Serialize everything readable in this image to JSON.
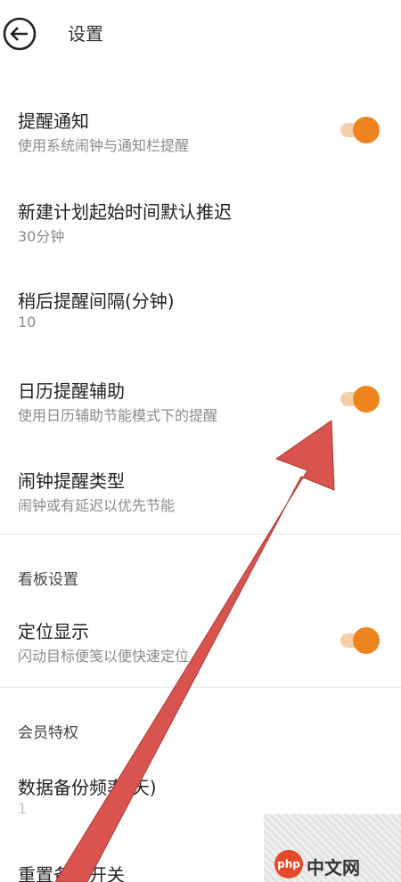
{
  "header": {
    "title": "设置",
    "back_icon": "arrow-left-circle-icon"
  },
  "settings": [
    {
      "title": "提醒通知",
      "subtitle": "使用系统闹钟与通知栏提醒",
      "toggle": true
    },
    {
      "title": "新建计划起始时间默认推迟",
      "subtitle": "30分钟"
    },
    {
      "title": "稍后提醒间隔(分钟)",
      "subtitle": "10"
    },
    {
      "title": "日历提醒辅助",
      "subtitle": "使用日历辅助节能模式下的提醒",
      "toggle": true
    },
    {
      "title": "闹钟提醒类型",
      "subtitle": "闹钟或有延迟以优先节能"
    }
  ],
  "sections": {
    "board": {
      "header": "看板设置",
      "items": [
        {
          "title": "定位显示",
          "subtitle": "闪动目标便笺以便快速定位",
          "toggle": true
        }
      ]
    },
    "member": {
      "header": "会员特权",
      "items": [
        {
          "title": "数据备份频率(天)",
          "subtitle": "1"
        },
        {
          "title": "重置备份开关"
        }
      ]
    }
  },
  "colors": {
    "accent": "#ee8420",
    "track": "#f6cfaa",
    "annotation_arrow": "#d9534f"
  },
  "watermark": {
    "text": "中文网",
    "logo": "php"
  }
}
